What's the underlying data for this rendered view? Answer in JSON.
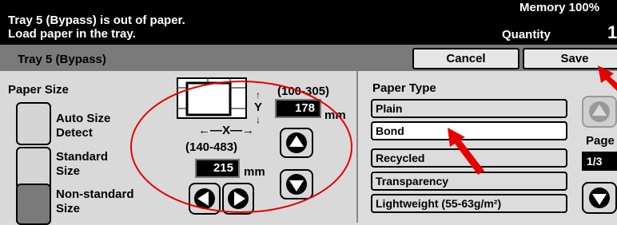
{
  "header": {
    "message_line1": "Tray 5 (Bypass) is out of paper.",
    "message_line2": "Load paper in the tray.",
    "memory": "Memory 100%",
    "quantity_label": "Quantity",
    "quantity_value": "1"
  },
  "titlebar": {
    "title": "Tray 5 (Bypass)",
    "cancel_label": "Cancel",
    "save_label": "Save"
  },
  "paper_size": {
    "label": "Paper Size",
    "options": [
      {
        "label": "Auto Size Detect",
        "selected": false
      },
      {
        "label": "Standard Size",
        "selected": false
      },
      {
        "label": "Non-standard Size",
        "selected": true
      }
    ],
    "y_dimension_symbol": "Y",
    "y_range": "(100-305)",
    "y_value": "178",
    "y_unit": "mm",
    "x_dimension_symbol": "X",
    "x_range": "(140-483)",
    "x_value": "215",
    "x_unit": "mm"
  },
  "paper_type": {
    "label": "Paper Type",
    "options": [
      {
        "label": "Plain"
      },
      {
        "label": "Bond"
      },
      {
        "label": "Recycled"
      },
      {
        "label": "Transparency"
      },
      {
        "label": "Lightweight (55-63g/m²)"
      }
    ],
    "page_label": "Page",
    "page_value": "1/3"
  },
  "annotation_color": "#e60000"
}
